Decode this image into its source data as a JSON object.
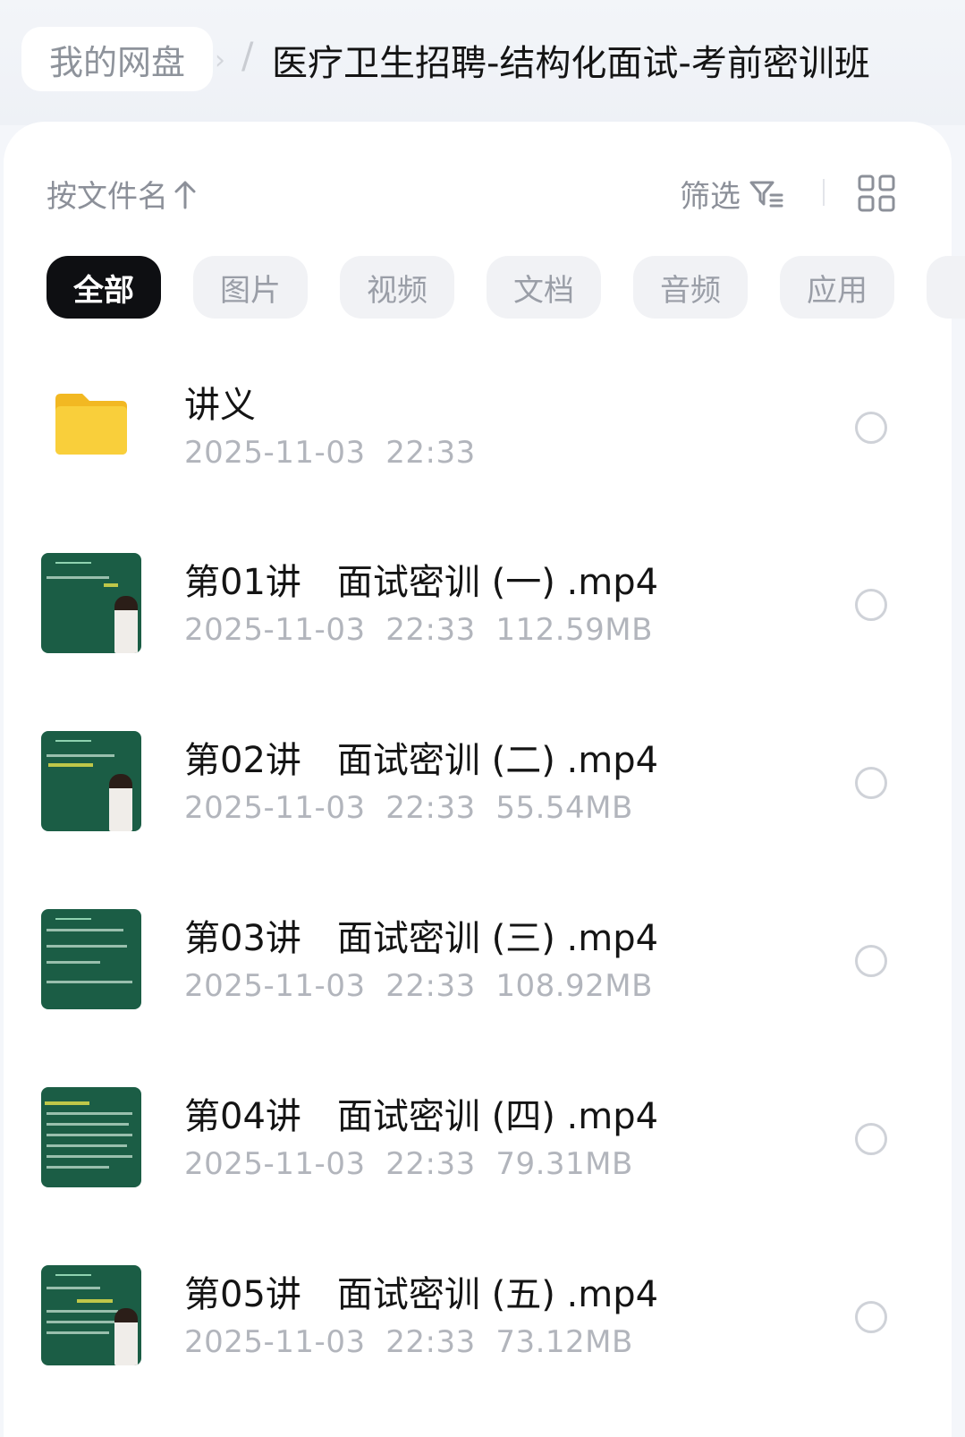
{
  "breadcrumb": {
    "root": "我的网盘",
    "current": "医疗卫生招聘-结构化面试-考前密训班"
  },
  "toolbar": {
    "sort_label": "按文件名",
    "filter_label": "筛选"
  },
  "categories": [
    "全部",
    "图片",
    "视频",
    "文档",
    "音频",
    "应用"
  ],
  "active_category": "全部",
  "files": [
    {
      "name": "讲义",
      "date": "2025-11-03",
      "time": "22:33",
      "size": "",
      "type": "folder"
    },
    {
      "name": "第01讲　面试密训 (一) .mp4",
      "date": "2025-11-03",
      "time": "22:33",
      "size": "112.59MB",
      "type": "video"
    },
    {
      "name": "第02讲　面试密训 (二) .mp4",
      "date": "2025-11-03",
      "time": "22:33",
      "size": "55.54MB",
      "type": "video"
    },
    {
      "name": "第03讲　面试密训 (三) .mp4",
      "date": "2025-11-03",
      "time": "22:33",
      "size": "108.92MB",
      "type": "video"
    },
    {
      "name": "第04讲　面试密训 (四) .mp4",
      "date": "2025-11-03",
      "time": "22:33",
      "size": "79.31MB",
      "type": "video"
    },
    {
      "name": "第05讲　面试密训 (五) .mp4",
      "date": "2025-11-03",
      "time": "22:33",
      "size": "73.12MB",
      "type": "video"
    }
  ],
  "colors": {
    "folder": "#f7c431",
    "thumb_bg": "#1b5d45",
    "active_chip": "#0e0f12"
  },
  "icons": {
    "sort": "arrow-up-icon",
    "filter": "filter-icon",
    "view": "grid-view-icon",
    "row_select": "radio-circle-icon"
  }
}
